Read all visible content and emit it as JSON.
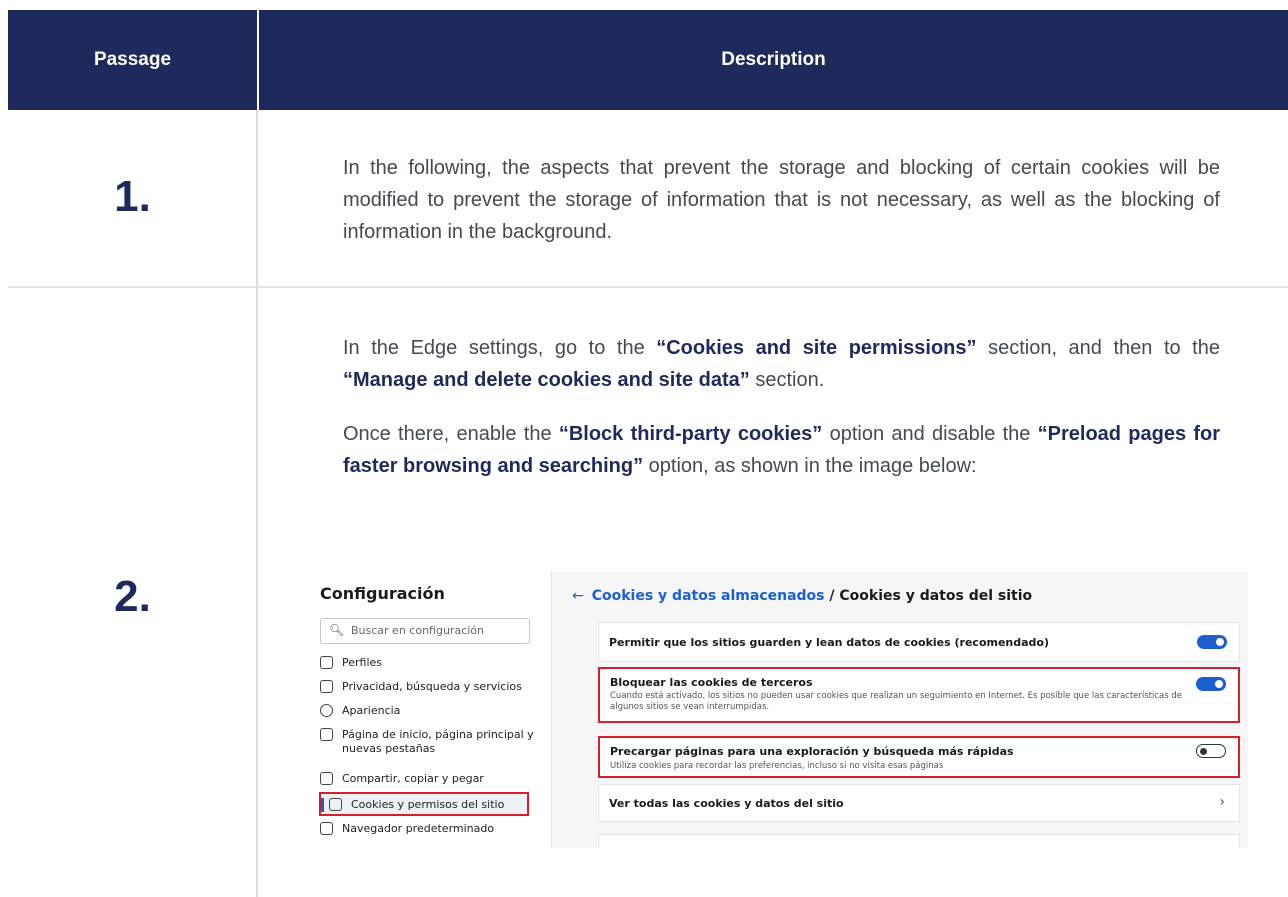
{
  "header": {
    "col1": "Passage",
    "col2": "Description"
  },
  "rows": [
    {
      "number": "1.",
      "text": "In the following, the aspects that prevent the storage and blocking of certain cookies will be modified to prevent the storage of information that is not necessary, as well as the blocking of information in the background."
    },
    {
      "number": "2.",
      "p1_a": "In the Edge settings, go to the ",
      "p1_b": "“Cookies and site permissions”",
      "p1_c": " section, and then to the ",
      "p1_d": "“Manage and delete cookies and site data”",
      "p1_e": " section.",
      "p2_a": "Once there, enable the ",
      "p2_b": "“Block third-party cookies”",
      "p2_c": " option and disable the ",
      "p2_d": "“Preload pages for faster browsing and searching”",
      "p2_e": " option, as shown in the image below:"
    }
  ],
  "screenshot": {
    "sidebar_title": "Configuración",
    "search_placeholder": "Buscar en configuración",
    "nav": [
      {
        "label": "Perfiles",
        "icon": "profile-icon"
      },
      {
        "label": "Privacidad, búsqueda y servicios",
        "icon": "lock-icon"
      },
      {
        "label": "Apariencia",
        "icon": "appearance-icon"
      },
      {
        "label": "Página de inicio, página principal y",
        "label2": "nuevas pestañas",
        "icon": "home-icon"
      },
      {
        "label": "Compartir, copiar y pegar",
        "icon": "share-icon"
      },
      {
        "label": "Cookies y permisos del sitio",
        "icon": "cookies-icon",
        "selected": true
      },
      {
        "label": "Navegador predeterminado",
        "icon": "browser-icon"
      }
    ],
    "breadcrumb_back": "←",
    "breadcrumb_link": "Cookies y datos almacenados",
    "breadcrumb_sep": " / ",
    "breadcrumb_current": "Cookies y datos del sitio",
    "settings": [
      {
        "title": "Permitir que los sitios guarden y lean datos de cookies (recomendado)",
        "toggle": "on"
      },
      {
        "title": "Bloquear las cookies de terceros",
        "sub": "Cuando está activado, los sitios no pueden usar cookies que realizan un seguimiento en Internet. Es posible que las características de algunos sitios se vean interrumpidas.",
        "toggle": "on",
        "highlight": true
      },
      {
        "title": "Precargar páginas para una exploración y búsqueda más rápidas",
        "sub": "Utiliza cookies para recordar las preferencias, incluso si no visita esas páginas",
        "toggle": "off",
        "highlight": true
      },
      {
        "title": "Ver todas las cookies y datos del sitio",
        "chevron": "›"
      }
    ],
    "colors": {
      "accent": "#1b5fd1",
      "highlight": "#d4202a",
      "header": "#1f2a5c"
    }
  }
}
